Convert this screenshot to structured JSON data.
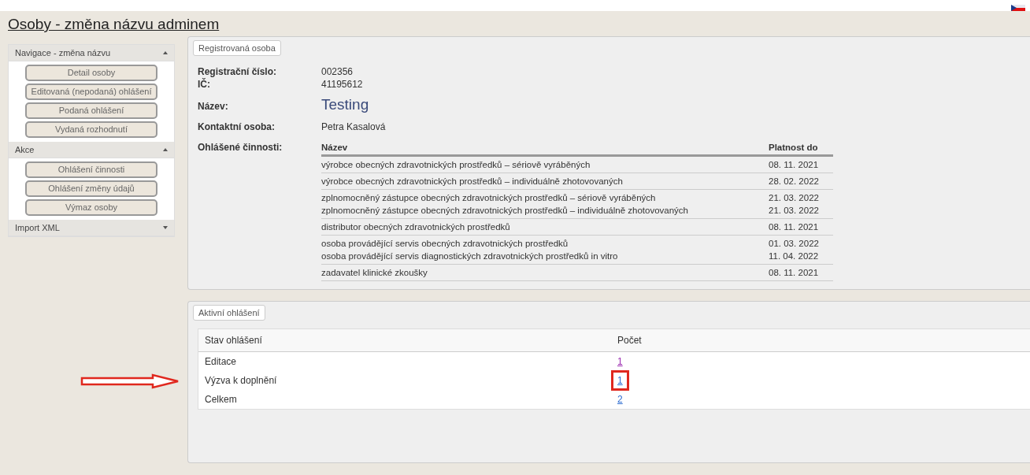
{
  "page_title": "Osoby - změna názvu adminem",
  "sidebar": [
    {
      "title": "Navigace - změna názvu",
      "expanded": true,
      "buttons": [
        "Detail osoby",
        "Editovaná (nepodaná) ohlášení",
        "Podaná ohlášení",
        "Vydaná rozhodnutí"
      ]
    },
    {
      "title": "Akce",
      "expanded": true,
      "buttons": [
        "Ohlášení činnosti",
        "Ohlášení změny údajů",
        "Výmaz osoby"
      ]
    },
    {
      "title": "Import XML",
      "expanded": false
    }
  ],
  "registered_person": {
    "legend": "Registrovaná osoba",
    "fields": [
      {
        "label": "Registrační číslo:",
        "value": "002356",
        "kind": "plain"
      },
      {
        "label": "IČ:",
        "value": "41195612",
        "kind": "plain"
      },
      {
        "label": "Název:",
        "value": "Testing",
        "kind": "title"
      },
      {
        "label": "Kontaktní osoba:",
        "value": "Petra Kasalová",
        "kind": "plain"
      }
    ],
    "activities_label": "Ohlášené činnosti:",
    "activities_columns": [
      "Název",
      "Platnost do"
    ],
    "activity_groups": [
      [
        {
          "name": "výrobce obecných zdravotnických prostředků – sériově vyráběných",
          "valid_to": "08. 11. 2021"
        }
      ],
      [
        {
          "name": "výrobce obecných zdravotnických prostředků – individuálně zhotovovaných",
          "valid_to": "28. 02. 2022"
        }
      ],
      [
        {
          "name": "zplnomocněný zástupce obecných zdravotnických prostředků – sériově vyráběných",
          "valid_to": "21. 03. 2022"
        },
        {
          "name": "zplnomocněný zástupce obecných zdravotnických prostředků – individuálně zhotovovaných",
          "valid_to": "21. 03. 2022"
        }
      ],
      [
        {
          "name": "distributor obecných zdravotnických prostředků",
          "valid_to": "08. 11. 2021"
        }
      ],
      [
        {
          "name": "osoba provádějící servis obecných zdravotnických prostředků",
          "valid_to": "01. 03. 2022"
        },
        {
          "name": "osoba provádějící servis diagnostických zdravotnických prostředků in vitro",
          "valid_to": "11. 04. 2022"
        }
      ],
      [
        {
          "name": "zadavatel klinické zkoušky",
          "valid_to": "08. 11. 2021"
        }
      ]
    ]
  },
  "active_reports": {
    "legend": "Aktivní ohlášení",
    "columns": [
      "Stav ohlášení",
      "Počet"
    ],
    "rows": [
      {
        "state": "Editace",
        "count": "1",
        "visited": true,
        "highlighted": false
      },
      {
        "state": "Výzva k doplnění",
        "count": "1",
        "visited": false,
        "highlighted": true
      },
      {
        "state": "Celkem",
        "count": "2",
        "visited": false,
        "highlighted": false
      }
    ]
  }
}
